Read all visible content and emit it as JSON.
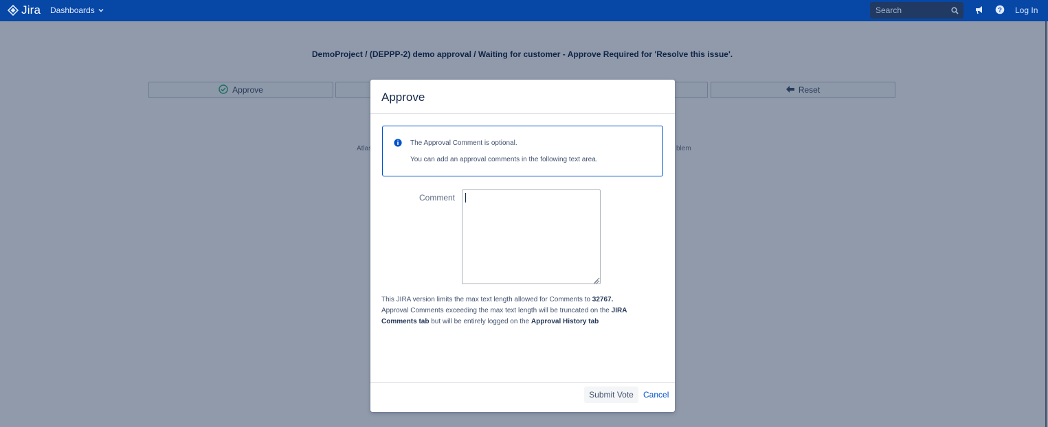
{
  "topbar": {
    "logo_text": "Jira",
    "nav_dashboards": "Dashboards",
    "search_placeholder": "Search",
    "login_label": "Log In",
    "icons": [
      "jira-logo-icon",
      "chevron-down-icon",
      "search-icon",
      "megaphone-icon",
      "help-icon"
    ]
  },
  "page": {
    "title": "DemoProject / (DEPPP-2) demo approval / Waiting for customer - Approve Required for 'Resolve this issue'.",
    "approve_label": "Approve",
    "reset_label": "Reset",
    "behind_left_fragment": "Atlas",
    "behind_right_fragment": "blem"
  },
  "dialog": {
    "title": "Approve",
    "info_line1": "The Approval Comment is optional.",
    "info_line2": "You can add an approval comments in the following text area.",
    "comment_label": "Comment",
    "comment_value": "",
    "note_line1_text": "This JIRA version limits the max text length allowed for Comments to ",
    "note_line1_bold": "32767.",
    "note_line2_text": "Approval Comments exceeding the max text length will be truncated on the ",
    "note_line2_bold": "JIRA Comments tab",
    "note_line3_text": " but will be entirely logged on the ",
    "note_line3_bold": "Approval History tab",
    "submit_label": "Submit Vote",
    "cancel_label": "Cancel"
  },
  "colors": {
    "topbar": "#0747a6",
    "link": "#0052cc",
    "info_border": "#0052cc",
    "approve_icon": "#36b37e"
  }
}
